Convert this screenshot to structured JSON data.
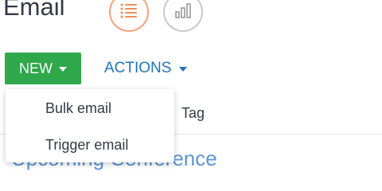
{
  "header": {
    "title": "Email"
  },
  "view_switch": {
    "list_icon": "list-icon",
    "chart_icon": "bar-chart-icon",
    "accent": "#f2a27a"
  },
  "toolbar": {
    "new_label": "NEW",
    "actions_label": "ACTIONS",
    "new_color": "#2ea84a",
    "actions_color": "#1e73be"
  },
  "new_menu": {
    "items": [
      {
        "label": "Bulk email"
      },
      {
        "label": "Trigger email"
      }
    ]
  },
  "table": {
    "columns": [
      "Tag"
    ],
    "rows": [
      {
        "title": "Upcoming Conference"
      }
    ]
  }
}
